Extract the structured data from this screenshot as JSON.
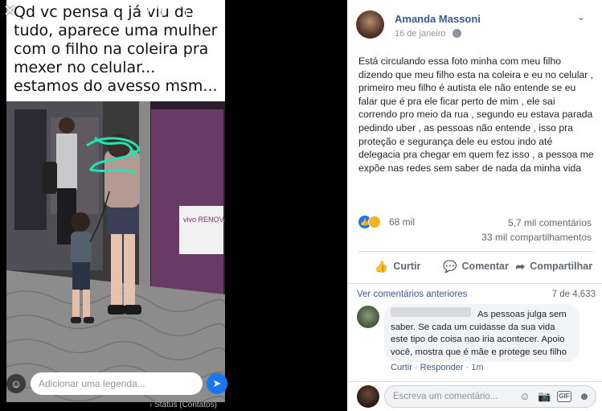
{
  "viewer": {
    "caption_lines": "Qd vc pensa q já viu de tudo, aparece uma mulher com o filho na coleira pra mexer no celular... estamos do avesso msm...",
    "caption_placeholder": "Adicionar uma legenda...",
    "status_text": "Status (Contatos)",
    "close_glyph": "✕",
    "emoji_glyph": "☺",
    "send_glyph": "➤",
    "store_sign": "vivo RENOVA"
  },
  "post": {
    "author": "Amanda Massoni",
    "date": "16 de janeiro",
    "text": "Está circulando essa foto minha com meu filho dizendo que meu filho esta na coleira e eu no celular , primeiro meu filho é autista ele não entende se eu falar que é pra ele ficar perto de mim , ele sai correndo pro meio da rua , segundo eu estava parada pedindo uber , as pessoas não entende , isso pra proteção e segurança dele eu estou indo até delegacia pra chegar em quem fez isso , a pessoa me expõe nas redes sem saber de nada da minha vida",
    "reaction_count": "68 mil",
    "comments_count": "5,7 mil comentários",
    "shares_count": "33 mil compartilhamentos",
    "chevron_glyph": "⌄"
  },
  "actions": {
    "like": "Curtir",
    "comment": "Comentar",
    "share": "Compartilhar",
    "like_glyph": "👍",
    "comment_glyph": "💬",
    "share_glyph": "➦"
  },
  "comments": {
    "more_label": "Ver comentários anteriores",
    "count_label": "7 de 4.633",
    "items": [
      {
        "text": "As pessoas julga sem saber. Se cada um cuidasse da sua vida este tipo de coisa nao iria acontecer. Apoio você, mostra que é mãe e protege seu filho",
        "like": "Curtir",
        "reply": "Responder",
        "time": "1m"
      }
    ],
    "placeholder": "Escreva um comentário...",
    "tools": {
      "emoji": "☺",
      "camera": "📷",
      "gif": "GIF",
      "sticker": "☻"
    }
  },
  "colors": {
    "link": "#385898",
    "accent": "#1877f2",
    "muted": "#606770"
  }
}
